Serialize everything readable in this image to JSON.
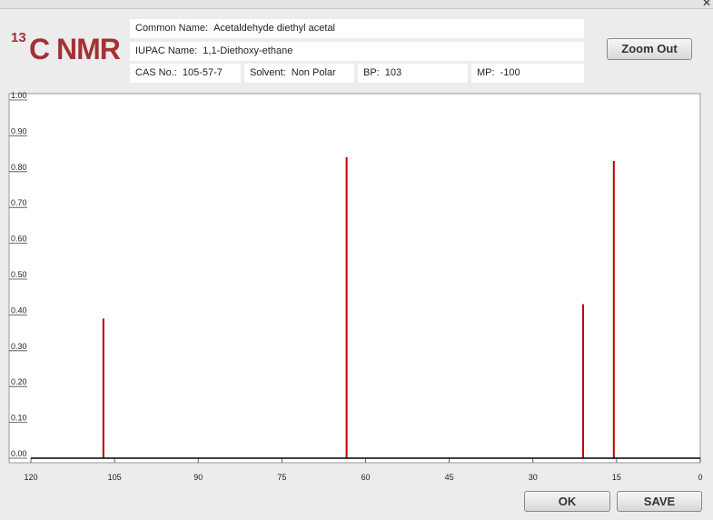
{
  "window": {
    "close_icon": "close-icon"
  },
  "logo": {
    "sup": "13",
    "main": "C NMR"
  },
  "info": {
    "common_name_label": "Common Name:",
    "common_name": "Acetaldehyde diethyl acetal",
    "iupac_label": "IUPAC Name:",
    "iupac_name": "1,1-Diethoxy-ethane",
    "cas_label": "CAS No.:",
    "cas": "105-57-7",
    "solvent_label": "Solvent:",
    "solvent": "Non Polar",
    "bp_label": "BP:",
    "bp": "103",
    "mp_label": "MP:",
    "mp": "-100"
  },
  "buttons": {
    "zoom_out": "Zoom Out",
    "ok": "OK",
    "save": "SAVE"
  },
  "colors": {
    "peak": "#c00000",
    "logo": "#a33235"
  },
  "chart_data": {
    "type": "bar",
    "title": "",
    "xlabel": "",
    "ylabel": "",
    "xlim": [
      120,
      0
    ],
    "ylim": [
      0,
      1.0
    ],
    "grid": false,
    "x_ticks": [
      "120",
      "105",
      "90",
      "75",
      "60",
      "45",
      "30",
      "15",
      "0"
    ],
    "y_ticks": [
      "0.00",
      "0.10",
      "0.20",
      "0.30",
      "0.40",
      "0.50",
      "0.60",
      "0.70",
      "0.80",
      "0.90",
      "1.00"
    ],
    "peaks": [
      {
        "x": 107.0,
        "y": 0.39
      },
      {
        "x": 63.4,
        "y": 0.84
      },
      {
        "x": 21.0,
        "y": 0.43
      },
      {
        "x": 15.5,
        "y": 0.83
      }
    ]
  }
}
